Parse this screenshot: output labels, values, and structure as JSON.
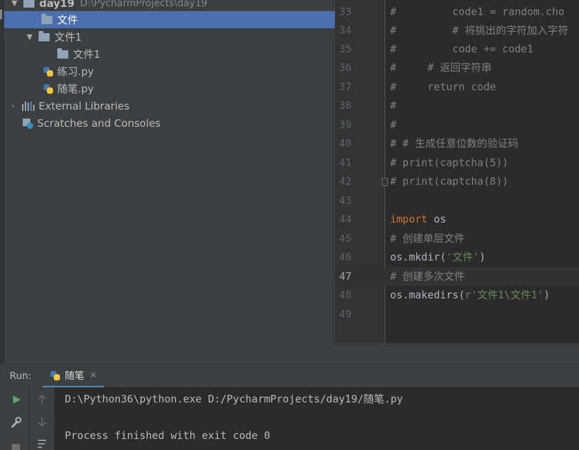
{
  "project_tree": {
    "items": [
      {
        "label": "day19",
        "path": "D:\\PycharmProjects\\day19"
      },
      {
        "label": "文件"
      },
      {
        "label": "文件1"
      },
      {
        "label": "文件1"
      },
      {
        "label": "练习.py"
      },
      {
        "label": "随笔.py"
      },
      {
        "label": "External Libraries"
      },
      {
        "label": "Scratches and Consoles"
      }
    ]
  },
  "editor": {
    "lines": [
      {
        "num": "33",
        "text": "#         code1 = random.cho"
      },
      {
        "num": "34",
        "text": "#         # 将挑出的字符加入字符"
      },
      {
        "num": "35",
        "text": "#         code += code1"
      },
      {
        "num": "36",
        "text": "#     # 返回字符串"
      },
      {
        "num": "37",
        "text": "#     return code"
      },
      {
        "num": "38",
        "text": "#"
      },
      {
        "num": "39",
        "text": "#"
      },
      {
        "num": "40",
        "text": "# # 生成任意位数的验证码"
      },
      {
        "num": "41",
        "text": "# print(captcha(5))"
      },
      {
        "num": "42",
        "text": "# print(captcha(8))"
      },
      {
        "num": "43",
        "text": ""
      },
      {
        "num": "44",
        "kw": "import",
        "rest": " os"
      },
      {
        "num": "45",
        "text": "# 创建单层文件"
      },
      {
        "num": "46",
        "pre": "os.mkdir(",
        "str": "'文件'",
        "post": ")"
      },
      {
        "num": "47",
        "text": "# 创建多次文件"
      },
      {
        "num": "48",
        "pre": "os.makedirs(",
        "str": "r'文件1\\文件1'",
        "post": ")"
      },
      {
        "num": "49",
        "text": ""
      }
    ]
  },
  "run_panel": {
    "label": "Run:",
    "tab": "随笔",
    "tab_close": "×",
    "console": [
      "D:\\Python36\\python.exe D:/PycharmProjects/day19/随笔.py",
      "Process finished with exit code 0"
    ]
  }
}
